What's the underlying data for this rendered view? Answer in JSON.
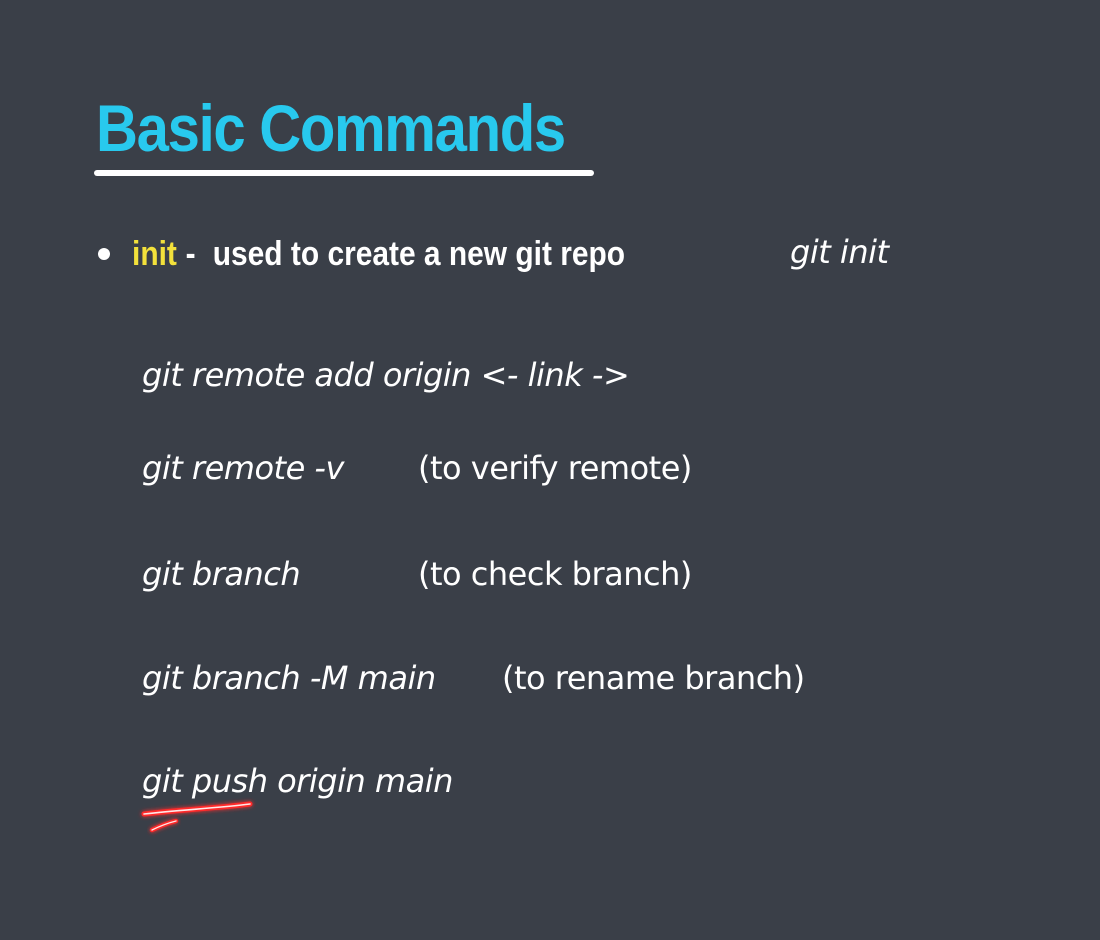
{
  "slide": {
    "title": "Basic Commands",
    "bullet": {
      "keyword": "init",
      "separator": "-",
      "description": "used to create a new git repo",
      "command": "git init"
    },
    "commands": [
      {
        "command": "git remote add origin <- link ->",
        "note": ""
      },
      {
        "command": "git remote -v",
        "note": "(to verify remote)"
      },
      {
        "command": "git branch",
        "note": "(to check branch)"
      },
      {
        "command": "git branch -M main",
        "note": "(to rename branch)"
      },
      {
        "command": "git push origin main",
        "note": ""
      }
    ]
  },
  "colors": {
    "background": "#3a3f48",
    "title": "#28c9ee",
    "keyword": "#f3e13b",
    "text": "#ffffff",
    "annotation": "#ff2a2a"
  }
}
